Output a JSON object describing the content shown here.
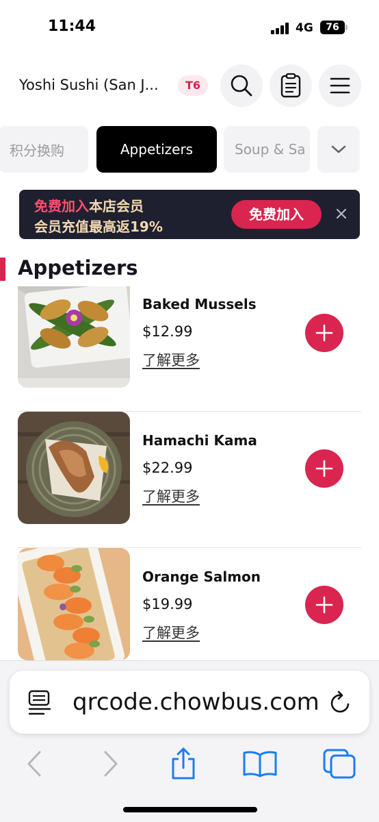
{
  "status_bar": {
    "time": "11:44",
    "network": "4G",
    "battery": "76"
  },
  "header": {
    "store_name": "Yoshi Sushi (San J...",
    "table_badge": "T6",
    "icons": [
      "search-icon",
      "order-list-icon",
      "hamburger-menu-icon"
    ]
  },
  "categories": {
    "tabs": [
      "积分换购",
      "Appetizers",
      "Soup & Sa"
    ],
    "active_tab": "Appetizers",
    "more_icon": "chevron-down-icon"
  },
  "banner": {
    "line1_highlight": "免费加入",
    "line1_rest": "本店会员",
    "line2": "会员充值最高返19%",
    "join_button": "免费加入",
    "close_icon": "close-icon",
    "colors": {
      "background": "#1e2030",
      "gold": "#f4d9b0",
      "accent": "#d9254f"
    }
  },
  "section": {
    "title": "Appetizers"
  },
  "items": [
    {
      "name": "Baked Mussels",
      "price": "$12.99",
      "more_link": "了解更多",
      "image": "baked-mussels-photo"
    },
    {
      "name": "Hamachi Kama",
      "price": "$22.99",
      "more_link": "了解更多",
      "image": "hamachi-kama-photo"
    },
    {
      "name": "Orange Salmon",
      "price": "$19.99",
      "more_link": "了解更多",
      "image": "orange-salmon-photo"
    }
  ],
  "browser": {
    "url": "qrcode.chowbus.com",
    "icons": [
      "reader-icon",
      "reload-icon",
      "back-icon",
      "forward-icon",
      "share-icon",
      "bookmarks-icon",
      "tabs-icon"
    ]
  },
  "theme": {
    "accent": "#d9254f",
    "tab_active_bg": "#000000"
  }
}
